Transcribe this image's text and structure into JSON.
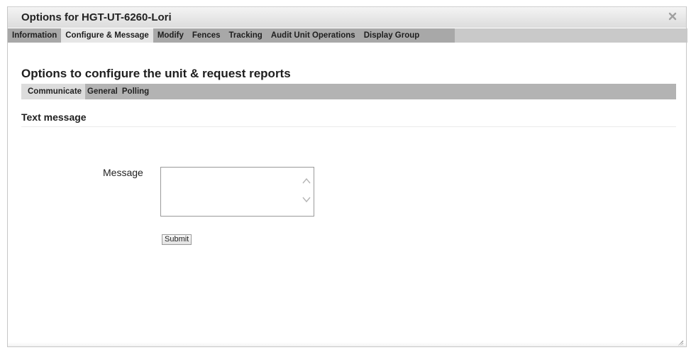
{
  "dialog": {
    "title": "Options for HGT-UT-6260-Lori",
    "close_icon": "close-icon"
  },
  "tabs": [
    {
      "label": "Information",
      "active": false
    },
    {
      "label": "Configure & Message",
      "active": true
    },
    {
      "label": "Modify",
      "active": false
    },
    {
      "label": "Fences",
      "active": false
    },
    {
      "label": "Tracking",
      "active": false
    },
    {
      "label": "Audit Unit Operations",
      "active": false
    },
    {
      "label": "Display Group",
      "active": false
    }
  ],
  "main": {
    "heading": "Options to configure the unit & request reports",
    "subtabs": [
      {
        "label": "Communicate",
        "active": true
      },
      {
        "label": "General",
        "active": false
      },
      {
        "label": "Polling",
        "active": false
      }
    ],
    "section_title": "Text message",
    "form": {
      "message_label": "Message",
      "message_value": "",
      "submit_label": "Submit"
    }
  },
  "colors": {
    "tab_bar": "#a8a8a8",
    "active_tab": "#e6e6e6",
    "subtab_bar": "#b3b3b3"
  }
}
